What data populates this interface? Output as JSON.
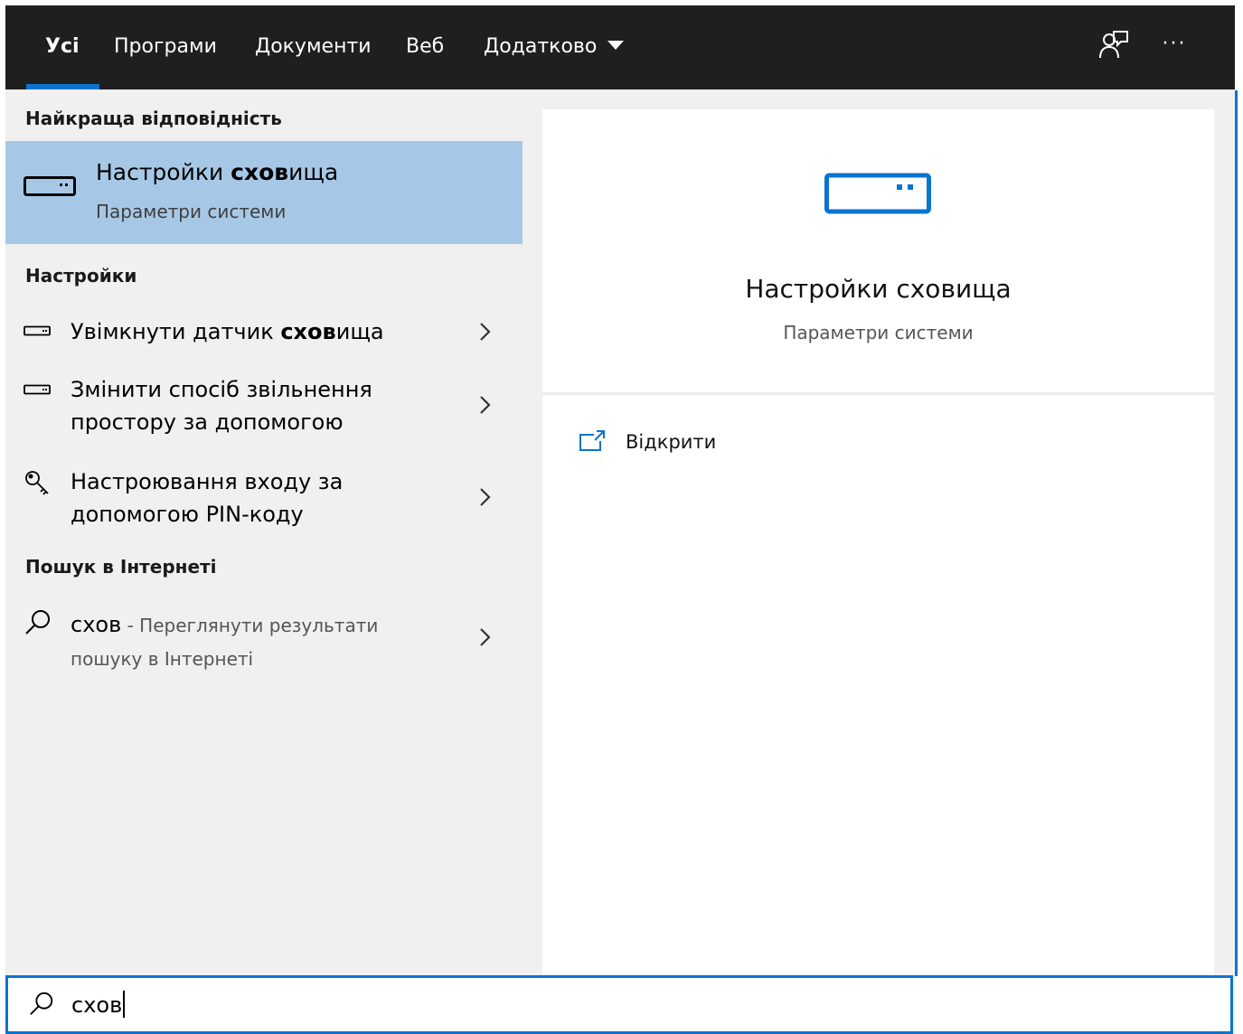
{
  "tabs": [
    {
      "label": "Усі",
      "active": true
    },
    {
      "label": "Програми"
    },
    {
      "label": "Документи"
    },
    {
      "label": "Веб"
    },
    {
      "label": "Додатково"
    }
  ],
  "toolbar": {
    "feedback_icon": "feedback-person-icon",
    "more_icon": "more-ellipsis-icon",
    "more_label": "···"
  },
  "left": {
    "best_match_header": "Найкраща відповідність",
    "best_match": {
      "title_normal": "Настройки ",
      "title_bold": "схов",
      "title_rest": "ища",
      "subtitle": "Параметри системи",
      "icon": "storage-drive-icon"
    },
    "settings_header": "Настройки",
    "settings_items": [
      {
        "line1_a": "Увімкнути датчик ",
        "line1_b": "схов",
        "line1_c": "ища",
        "icon": "storage-drive-icon"
      },
      {
        "line1": "Змінити спосіб звільнення",
        "line2": "простору за допомогою",
        "icon": "storage-drive-icon"
      },
      {
        "line1": "Настроювання входу за",
        "line2": "допомогою PIN-коду",
        "icon": "key-icon"
      }
    ],
    "web_header": "Пошук в Інтернеті",
    "web_item": {
      "query": "схов",
      "suffix": " - Переглянути результати",
      "line2": "пошуку в Інтернеті",
      "icon": "search-icon"
    }
  },
  "preview": {
    "title": "Настройки сховища",
    "subtitle": "Параметри системи",
    "icon": "storage-drive-icon",
    "open_label": "Відкрити",
    "open_icon": "open-external-icon"
  },
  "search": {
    "value": "схов",
    "icon": "search-icon"
  },
  "colors": {
    "accent": "#0a74d0",
    "topbar": "#1f1f1f",
    "selected": "#a6c8e6",
    "pane": "#f0f0f0"
  }
}
